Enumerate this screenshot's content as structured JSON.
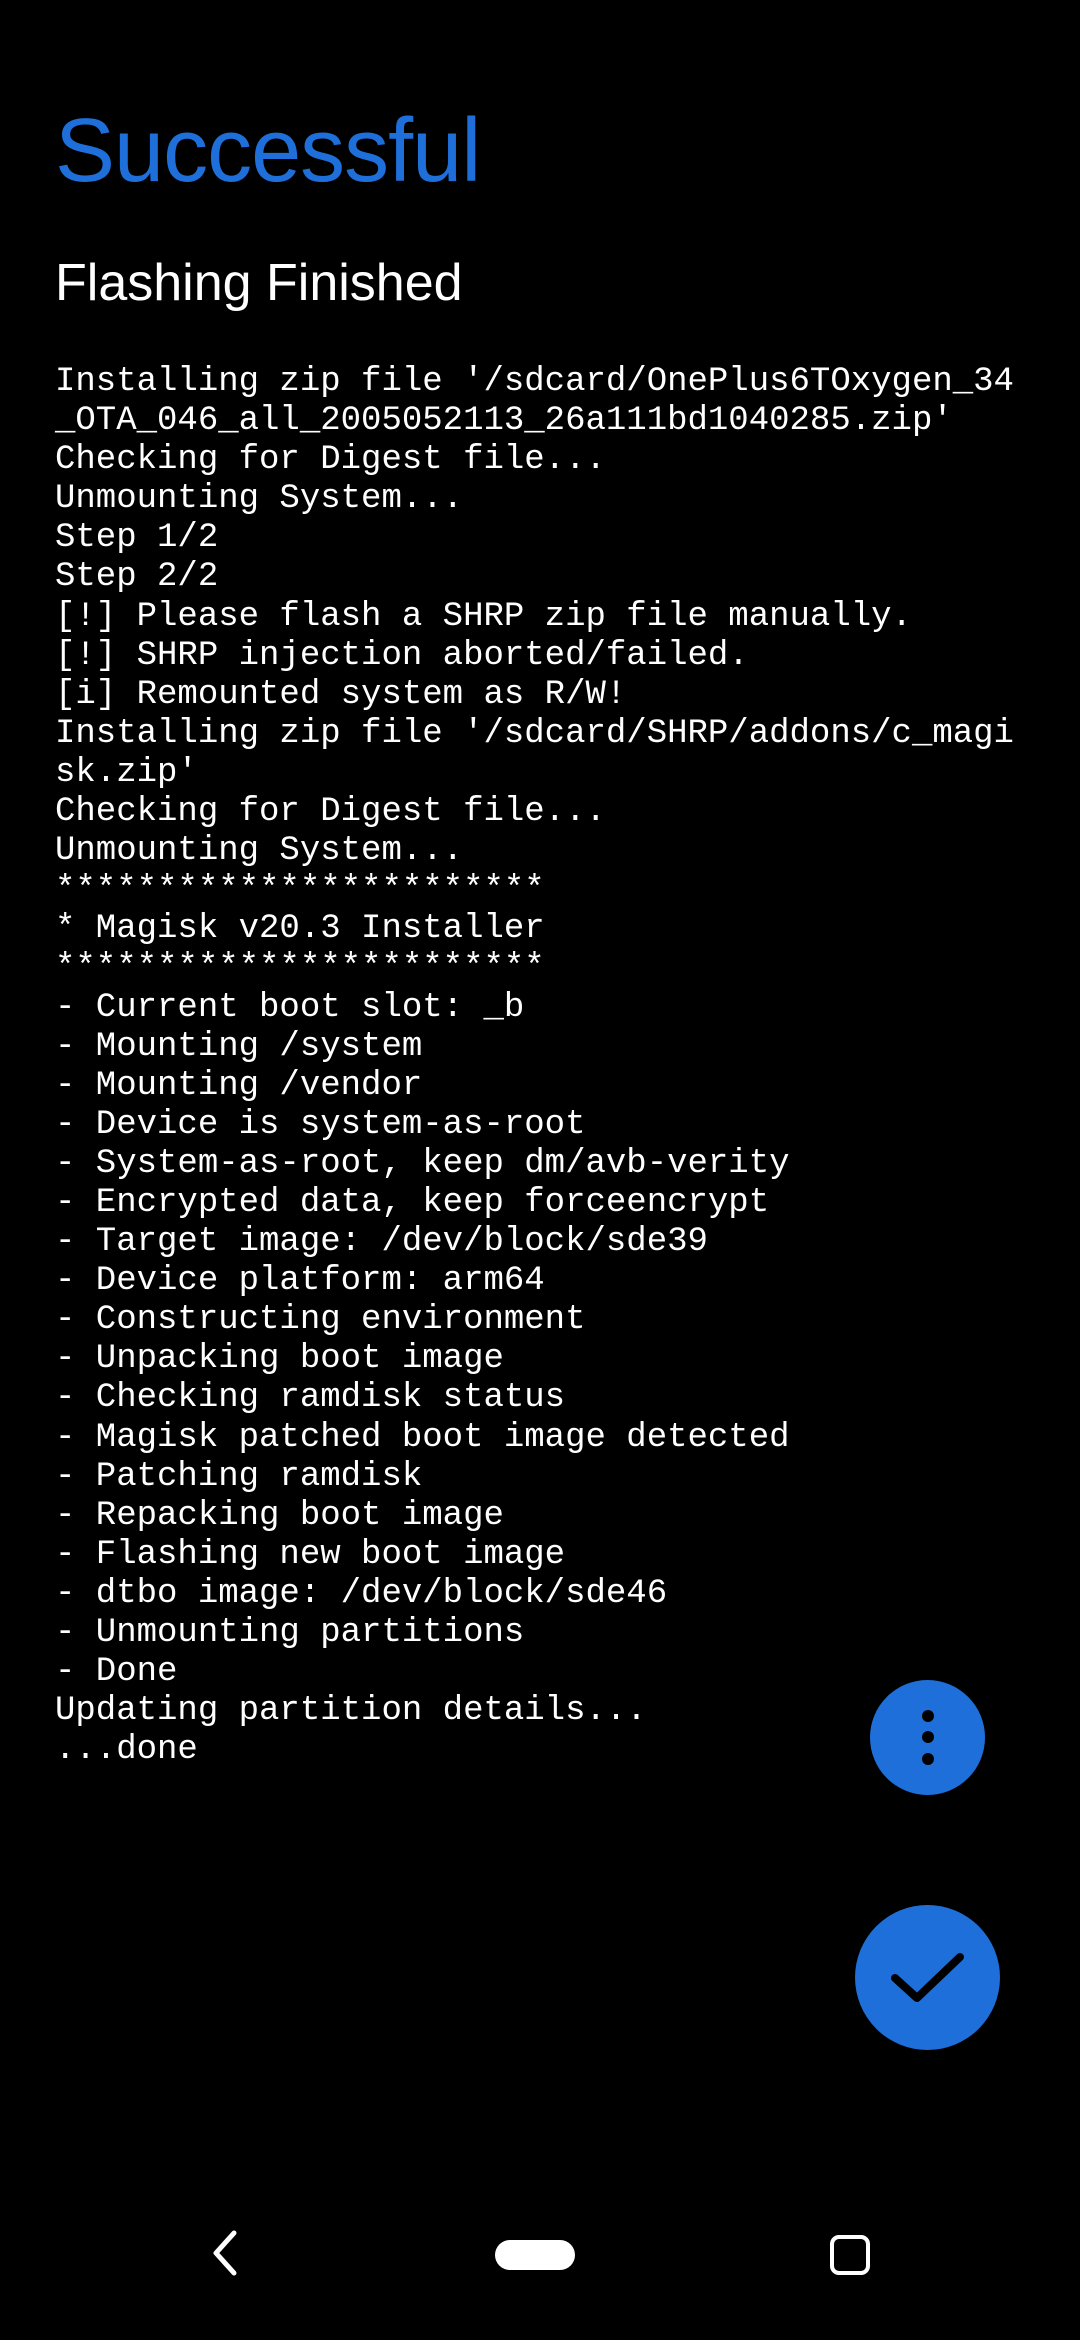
{
  "header": {
    "title": "Successful",
    "subtitle": "Flashing Finished"
  },
  "terminal": {
    "lines": [
      "Installing zip file '/sdcard/OnePlus6TOxygen_34_OTA_046_all_2005052113_26a111bd1040285.zip'",
      "Checking for Digest file...",
      "Unmounting System...",
      "Step 1/2",
      "Step 2/2",
      "[!] Please flash a SHRP zip file manually.",
      "[!] SHRP injection aborted/failed.",
      "[i] Remounted system as R/W!",
      "Installing zip file '/sdcard/SHRP/addons/c_magisk.zip'",
      "Checking for Digest file...",
      "Unmounting System...",
      "************************",
      "* Magisk v20.3 Installer",
      "************************",
      "- Current boot slot: _b",
      "- Mounting /system",
      "- Mounting /vendor",
      "- Device is system-as-root",
      "- System-as-root, keep dm/avb-verity",
      "- Encrypted data, keep forceencrypt",
      "- Target image: /dev/block/sde39",
      "- Device platform: arm64",
      "- Constructing environment",
      "- Unpacking boot image",
      "- Checking ramdisk status",
      "- Magisk patched boot image detected",
      "- Patching ramdisk",
      "- Repacking boot image",
      "- Flashing new boot image",
      "- dtbo image: /dev/block/sde46",
      "- Unmounting partitions",
      "- Done",
      "Updating partition details...",
      "...done"
    ]
  },
  "colors": {
    "accent": "#1e6fd9",
    "background": "#000000",
    "text": "#ffffff"
  }
}
